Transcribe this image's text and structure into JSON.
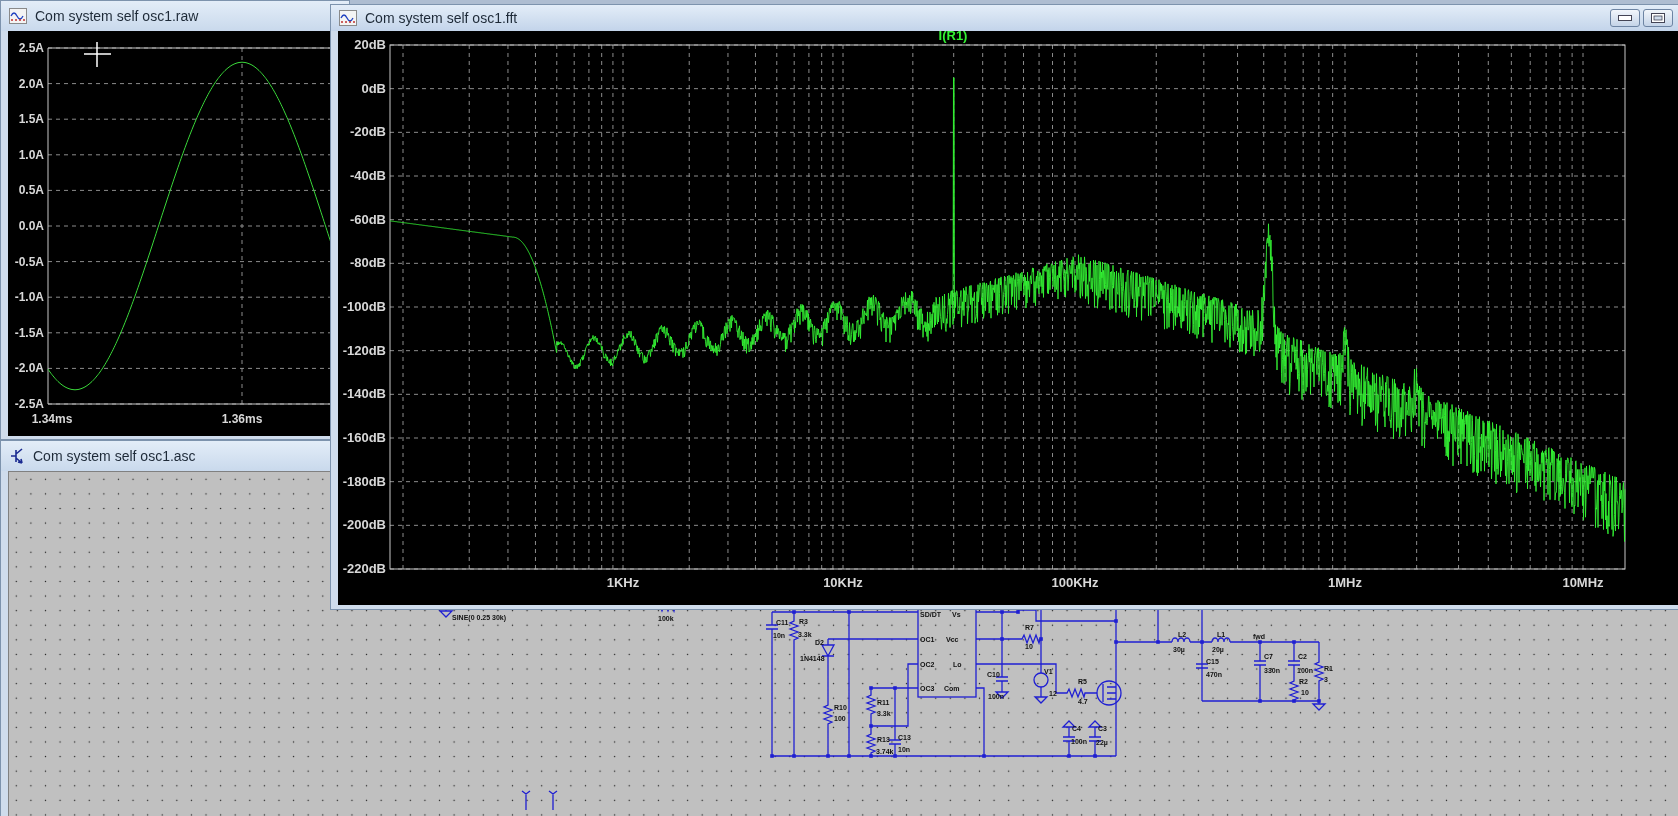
{
  "waveform_window": {
    "title": "Com system self osc1.raw",
    "y_ticks": [
      "2.5A",
      "2.0A",
      "1.5A",
      "1.0A",
      "0.5A",
      "0.0A",
      "-0.5A",
      "-1.0A",
      "-1.5A",
      "-2.0A",
      "-2.5A"
    ],
    "x_ticks": [
      "1.34ms",
      "1.36ms"
    ]
  },
  "fft_window": {
    "title": "Com system self osc1.fft",
    "trace_label": "I(R1)",
    "y_ticks": [
      "20dB",
      "0dB",
      "-20dB",
      "-40dB",
      "-60dB",
      "-80dB",
      "-100dB",
      "-120dB",
      "-140dB",
      "-160dB",
      "-180dB",
      "-200dB",
      "-220dB"
    ],
    "x_ticks": [
      "1KHz",
      "10KHz",
      "100KHz",
      "1MHz",
      "10MHz"
    ]
  },
  "schematic_window": {
    "title": "Com system self osc1.asc",
    "labels": [
      "SINE(0 0.25 30k)",
      "100k",
      "C11",
      "10n",
      "R3",
      "3.3k",
      "D2",
      "1N4148",
      "R10",
      "100",
      "R11",
      "3.3k",
      "R13",
      "3.74k",
      "C13",
      "10n",
      "SD/DT",
      "Vs",
      "OC1",
      "Vcc",
      "OC2",
      "Lo",
      "OC3",
      "Com",
      "C10",
      "100n",
      "R7",
      "10",
      "V1",
      "12",
      "R5",
      "4.7",
      "C4",
      "100n",
      "C3",
      "22µ",
      "L2",
      "30µ",
      "L1",
      "20µ",
      "fwd",
      "C15",
      "470n",
      "C7",
      "330n",
      "C2",
      "100n",
      "R2",
      "10",
      "R1",
      "3"
    ]
  }
}
